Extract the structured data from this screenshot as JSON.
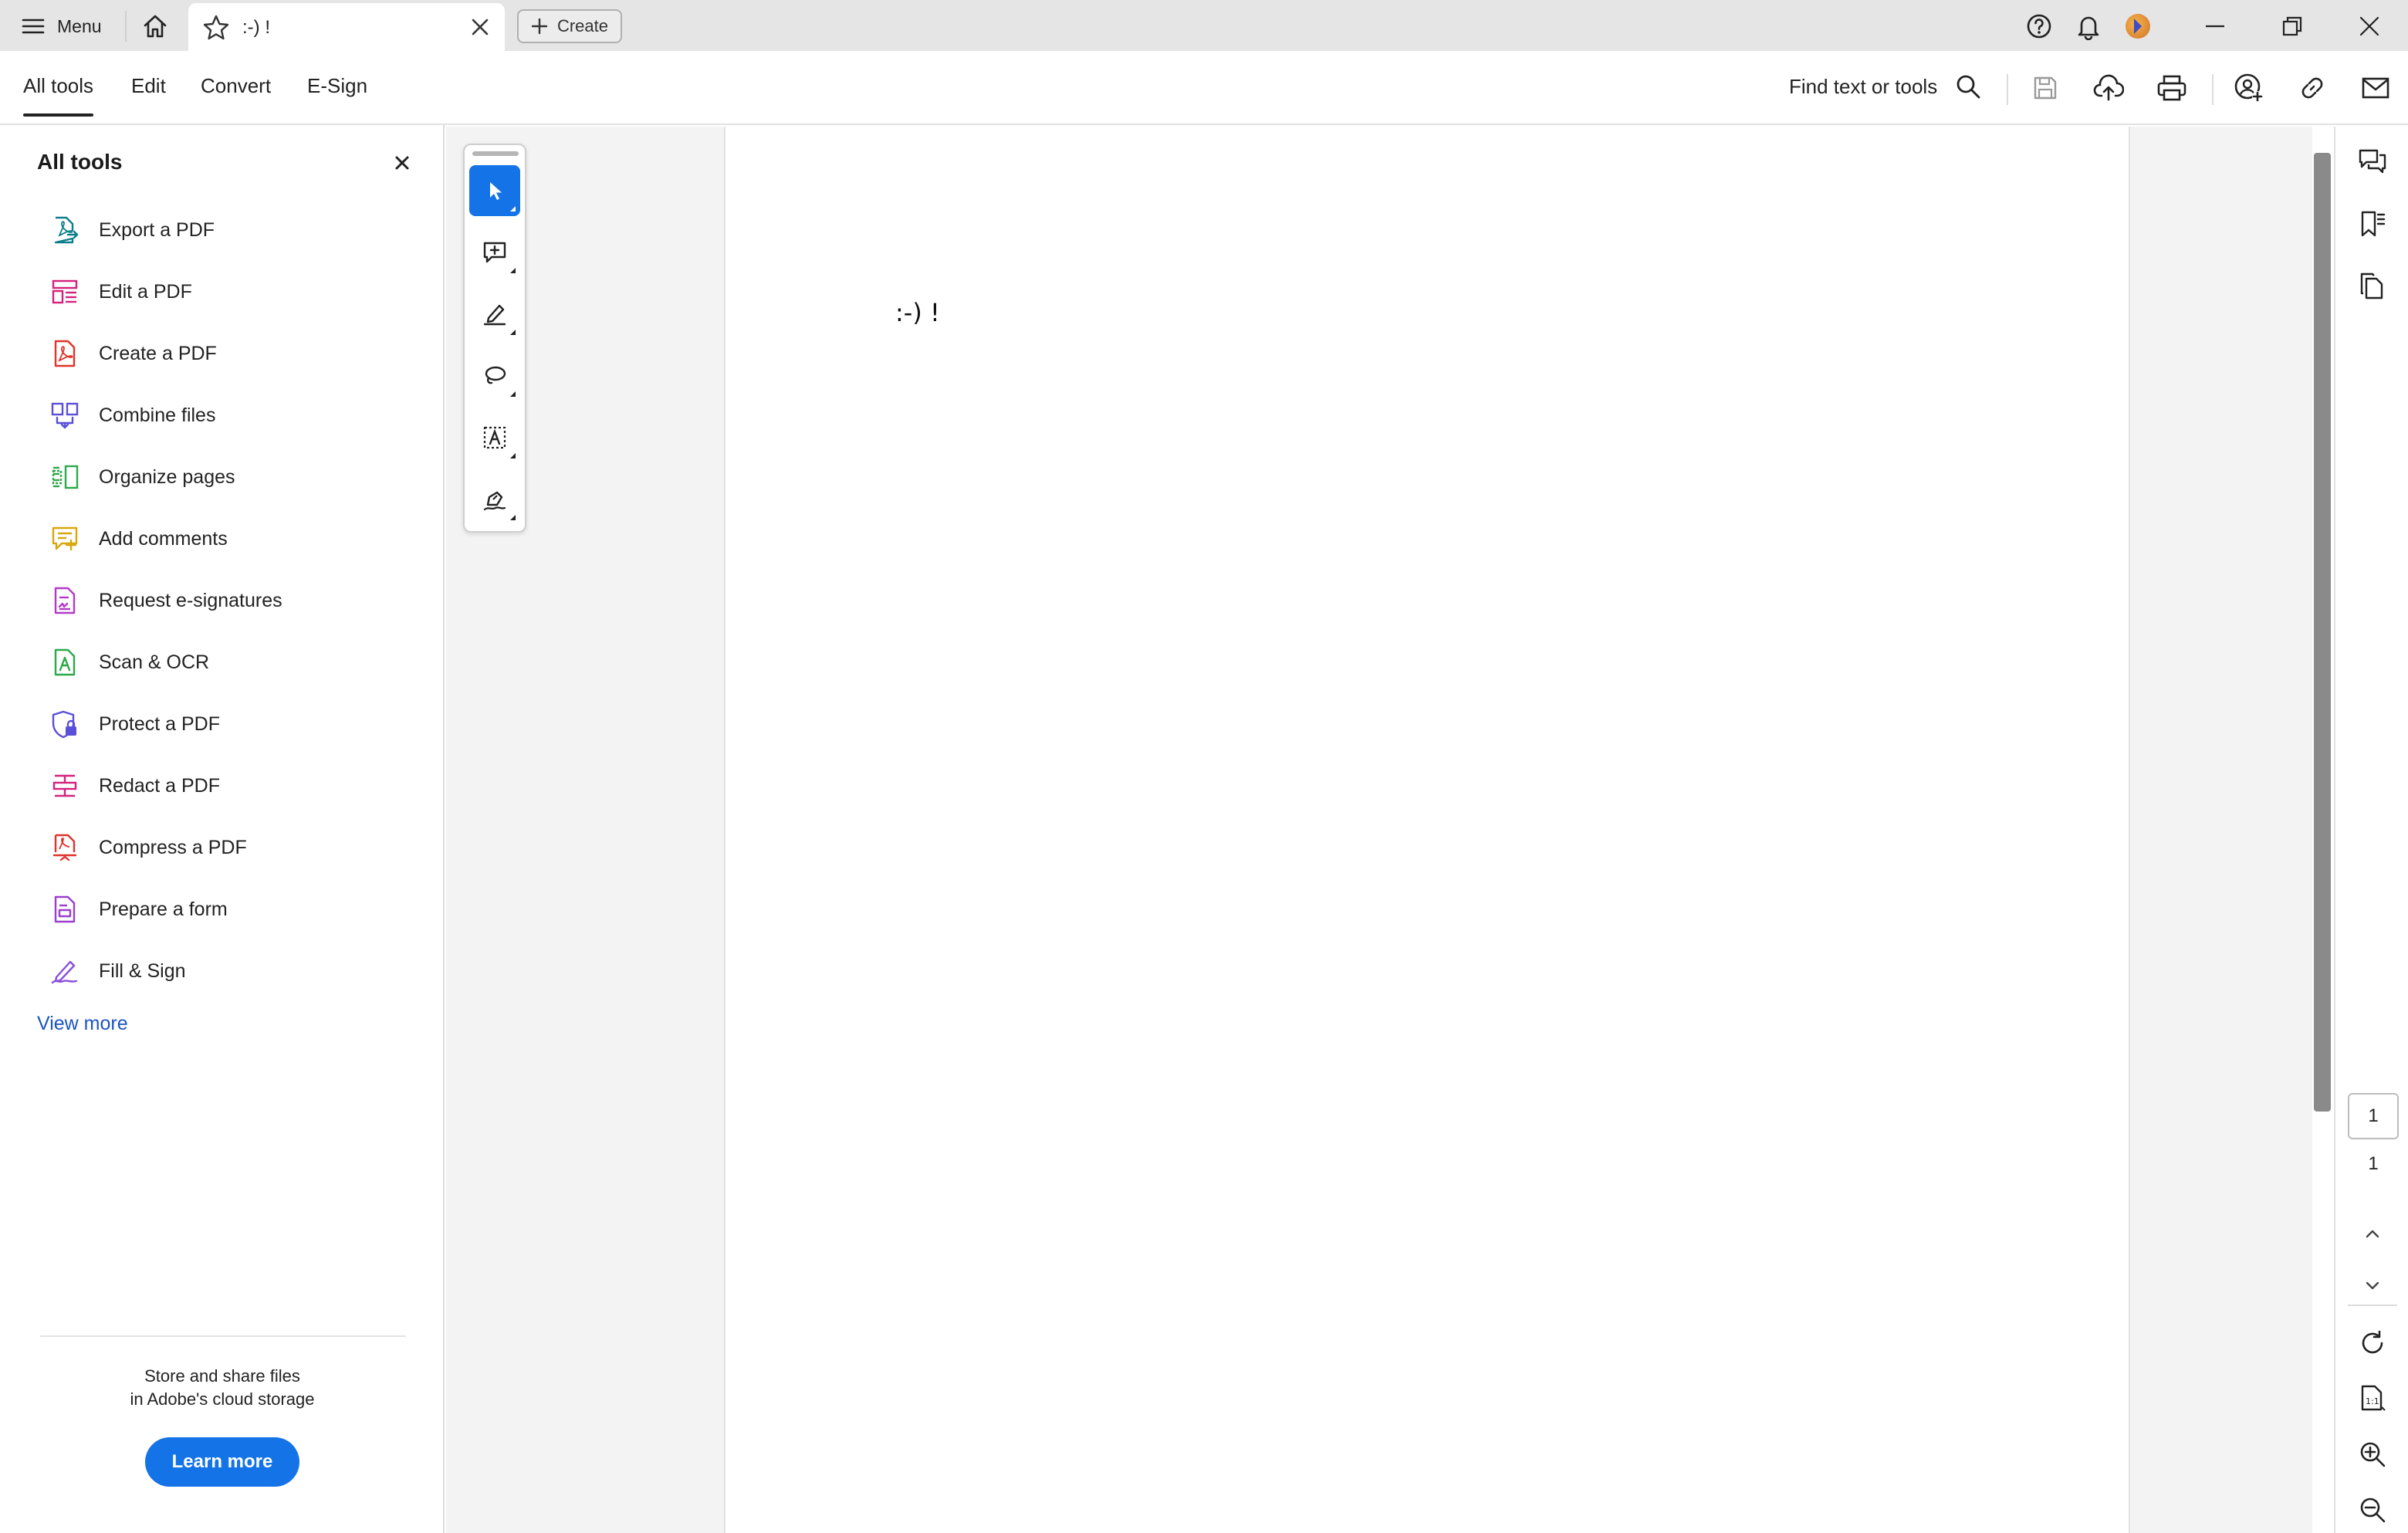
{
  "titlebar": {
    "menu_label": "Menu",
    "tab_title": ":-) !",
    "create_label": "Create"
  },
  "toolbar": {
    "tabs": [
      "All tools",
      "Edit",
      "Convert",
      "E-Sign"
    ],
    "find_label": "Find text or tools"
  },
  "left_panel": {
    "title": "All tools",
    "tools": [
      {
        "label": "Export a PDF",
        "icon": "export-pdf-icon",
        "color": "#0d7e8c"
      },
      {
        "label": "Edit a PDF",
        "icon": "edit-pdf-icon",
        "color": "#d4227d"
      },
      {
        "label": "Create a PDF",
        "icon": "create-pdf-icon",
        "color": "#e0332b"
      },
      {
        "label": "Combine files",
        "icon": "combine-files-icon",
        "color": "#5a4fd8"
      },
      {
        "label": "Organize pages",
        "icon": "organize-pages-icon",
        "color": "#2ea84a"
      },
      {
        "label": "Add comments",
        "icon": "add-comments-icon",
        "color": "#d9a70b"
      },
      {
        "label": "Request e-signatures",
        "icon": "request-esignatures-icon",
        "color": "#b23ac9"
      },
      {
        "label": "Scan & OCR",
        "icon": "scan-ocr-icon",
        "color": "#2ea84a"
      },
      {
        "label": "Protect a PDF",
        "icon": "protect-pdf-icon",
        "color": "#5a4fd8"
      },
      {
        "label": "Redact a PDF",
        "icon": "redact-pdf-icon",
        "color": "#d4227d"
      },
      {
        "label": "Compress a PDF",
        "icon": "compress-pdf-icon",
        "color": "#e0332b"
      },
      {
        "label": "Prepare a form",
        "icon": "prepare-form-icon",
        "color": "#9b3fcf"
      },
      {
        "label": "Fill & Sign",
        "icon": "fill-sign-icon",
        "color": "#8a4fd8"
      }
    ],
    "view_more": "View more",
    "promo_line1": "Store and share files",
    "promo_line2": "in Adobe's cloud storage",
    "learn_more": "Learn more"
  },
  "document": {
    "page_text": ":-) !"
  },
  "page_nav": {
    "current_page": "1",
    "total_pages": "1"
  },
  "colors": {
    "accent": "#1473e6",
    "link": "#1a55c2"
  }
}
